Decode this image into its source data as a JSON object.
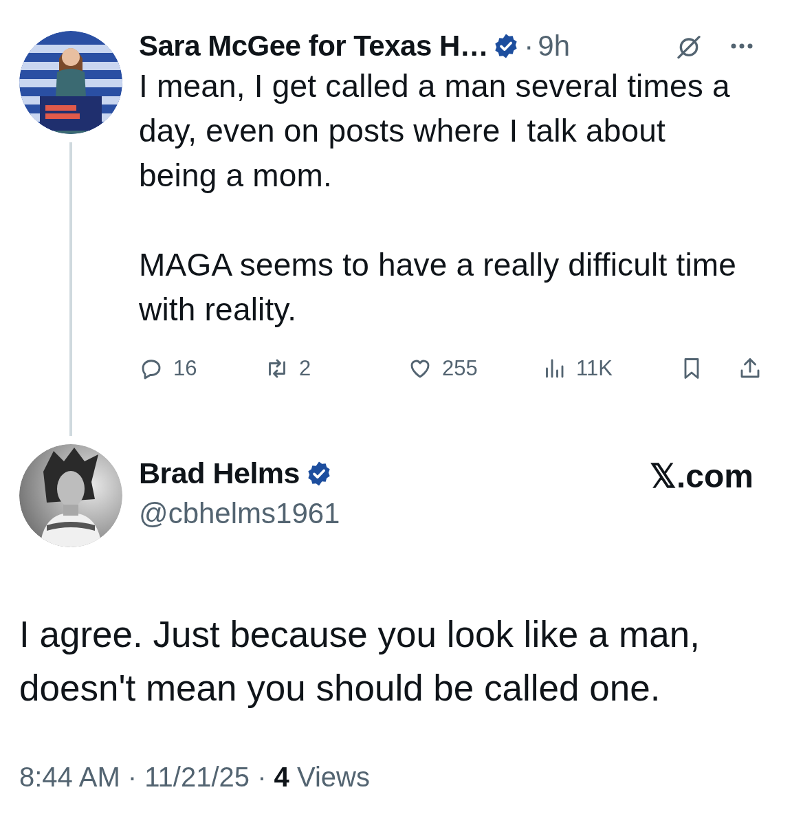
{
  "parent_post": {
    "author": "Sara McGee for Texas H…",
    "verified": true,
    "separator": "·",
    "time": "9h",
    "text": [
      "I mean, I get called a man several times a day, even on posts where I talk about being a mom.",
      "MAGA seems to have a really difficult time with reality."
    ],
    "actions": [
      {
        "kind": "reply",
        "count": "16"
      },
      {
        "kind": "repost",
        "count": "2"
      },
      {
        "kind": "like",
        "count": "255"
      },
      {
        "kind": "views",
        "count": "11K"
      },
      {
        "kind": "bookmark"
      },
      {
        "kind": "share"
      }
    ]
  },
  "reply_post": {
    "author": "Brad Helms",
    "verified": true,
    "handle": "@cbhelms1961",
    "brand": "𝕏.com",
    "text": "I agree. Just because you look like a man, doesn't mean you should be called one.",
    "footer": "8:44 AM · 11/21/25 · **4** Views"
  }
}
